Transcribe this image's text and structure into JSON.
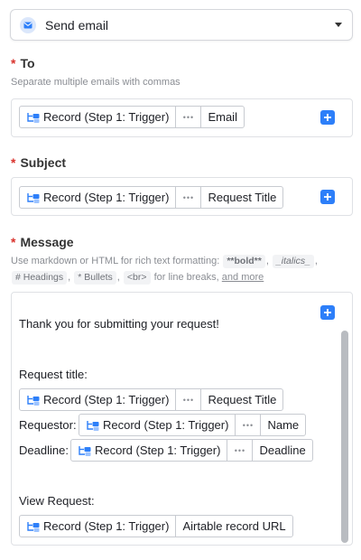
{
  "action": {
    "label": "Send email",
    "icon": "mail-icon"
  },
  "record_pill": {
    "label": "Record (Step 1: Trigger)",
    "icon": "record-source-icon",
    "more": "•••"
  },
  "to_field": {
    "required": "*",
    "label": "To",
    "helper": "Separate multiple emails with commas",
    "value": "Email"
  },
  "subject_field": {
    "required": "*",
    "label": "Subject",
    "value": "Request Title"
  },
  "message_field": {
    "required": "*",
    "label": "Message",
    "helper": {
      "intro": "Use markdown or HTML for rich text formatting: ",
      "bold": "**bold**",
      "italics": "_italics_",
      "headings": "# Headings",
      "bullets": "* Bullets",
      "br": "<br>",
      "suffix": " for line breaks, ",
      "link": "and more",
      "sep": ","
    },
    "lines": {
      "greeting": "Thank you for submitting your request!",
      "request_title_label": "Request title:",
      "request_title_value": "Request Title",
      "requestor_label": "Requestor:",
      "requestor_value": "Name",
      "deadline_label": "Deadline:",
      "deadline_value": "Deadline",
      "view_label": "View Request:",
      "view_value": "Airtable record URL"
    }
  },
  "colors": {
    "accent": "#2d7ff9",
    "required": "#d9312b",
    "helper": "#8a8d93"
  }
}
